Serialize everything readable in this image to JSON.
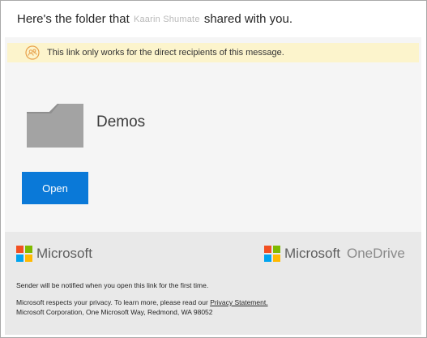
{
  "header": {
    "prefix": "Here's the folder that",
    "sender_name": "Kaarin Shumate",
    "suffix": "shared with you."
  },
  "banner": {
    "icon": "people-icon",
    "text": "This link only works for the direct recipients of this message."
  },
  "folder": {
    "icon": "folder-icon",
    "name": "Demos"
  },
  "open_button": {
    "label": "Open"
  },
  "footer": {
    "logo_left": "Microsoft",
    "logo_right_primary": "Microsoft",
    "logo_right_secondary": "OneDrive",
    "notify_text": "Sender will be notified when you open this link for the first time.",
    "privacy_prefix": "Microsoft respects your privacy. To learn more, please read our ",
    "privacy_link": "Privacy Statement.",
    "address": "Microsoft Corporation, One Microsoft Way, Redmond, WA 98052"
  },
  "colors": {
    "accent": "#0a79d8",
    "banner_bg": "#fcf4cc",
    "banner_icon": "#e8a04a",
    "ms_red": "#f25022",
    "ms_green": "#7fba00",
    "ms_blue": "#00a4ef",
    "ms_yellow": "#ffb900"
  }
}
